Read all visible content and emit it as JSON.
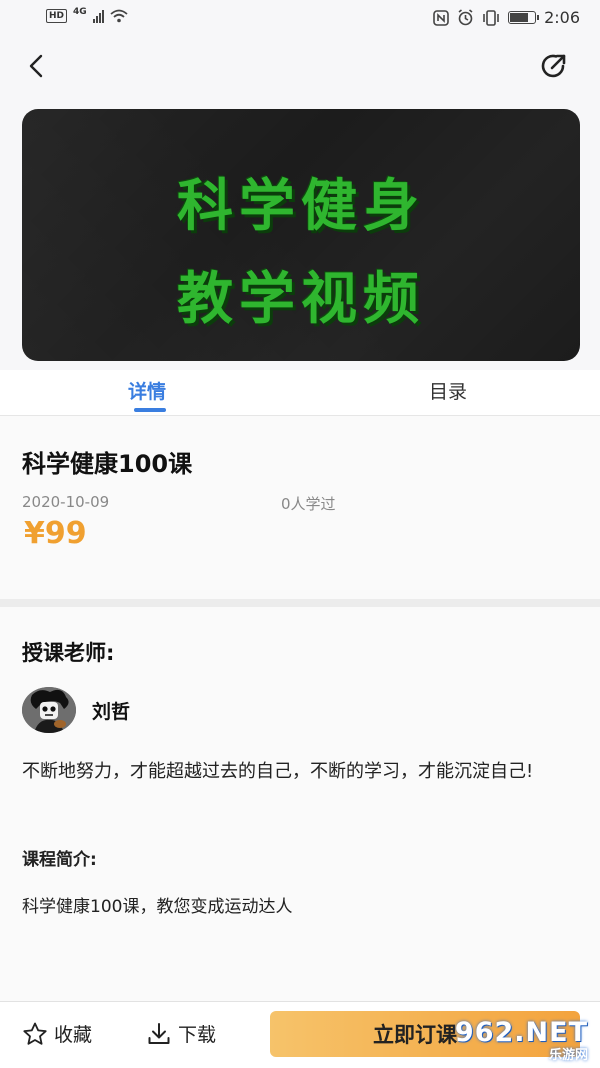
{
  "status_bar": {
    "network_badge": "HD",
    "network_type": "4G",
    "time": "2:06",
    "icons": [
      "nfc-icon",
      "alarm-icon",
      "vibrate-icon",
      "battery-icon"
    ],
    "battery_level": 0.8
  },
  "nav": {
    "back_icon": "chevron-left-icon",
    "share_icon": "share-circle-icon"
  },
  "banner": {
    "line1": "科学健身",
    "line2": "教学视频",
    "text_color": "#2fb62f",
    "background": "#1c1c1c"
  },
  "tabs": [
    {
      "label": "详情",
      "active": true
    },
    {
      "label": "目录",
      "active": false
    }
  ],
  "course": {
    "title": "科学健康100课",
    "date": "2020-10-09",
    "learned": "0人学过",
    "price": "¥99",
    "price_color": "#f0a030"
  },
  "teacher": {
    "heading": "授课老师:",
    "name": "刘哲",
    "motto": "不断地努力，才能超越过去的自己，不断的学习，才能沉淀自己!"
  },
  "intro": {
    "heading": "课程简介:",
    "text": "科学健康100课，教您变成运动达人"
  },
  "bottom_bar": {
    "favorite_label": "收藏",
    "download_label": "下载",
    "subscribe_label": "立即订课",
    "accent": "#f3a33d"
  },
  "watermark": {
    "main": "962.NET",
    "sub": "乐游网"
  },
  "accent_color": "#3a7ee0"
}
